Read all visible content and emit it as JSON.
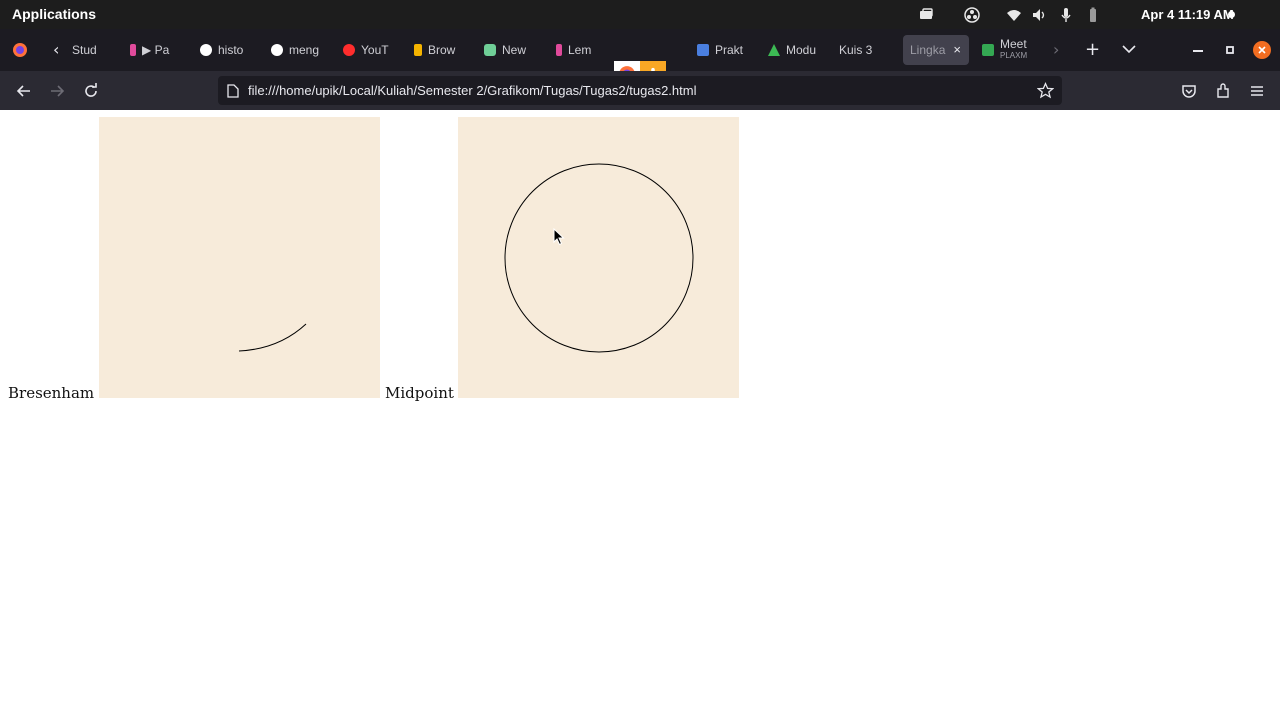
{
  "topbar": {
    "applications": "Applications",
    "clock": "Apr 4  11:19 AM",
    "icons": [
      "screen-icon",
      "obs-icon",
      "wifi-icon",
      "volume-icon",
      "mic-icon",
      "battery-icon"
    ]
  },
  "tabs": [
    {
      "label": "Stud",
      "color": "#c0c0c0"
    },
    {
      "label": "▶ Pa",
      "color": "#e04a9b"
    },
    {
      "label": "histo",
      "color": "#ffffff"
    },
    {
      "label": "meng",
      "color": "#ffffff"
    },
    {
      "label": "YouT",
      "color": "#ff2d2d"
    },
    {
      "label": "Brow",
      "color": "#f5b400"
    },
    {
      "label": "New",
      "color": "#6fcf97"
    },
    {
      "label": "Lem",
      "color": "#e04a9b"
    },
    {
      "label": "Prakt",
      "color": "#4a7fe0"
    },
    {
      "label": "Modu",
      "color": "#3cba54"
    },
    {
      "label": "Kuis 3",
      "color": ""
    },
    {
      "label": "Lingka",
      "color": ""
    },
    {
      "label": "Meet",
      "color": "#34a853"
    }
  ],
  "tab_sub": "PLAXM",
  "tab_close": "×",
  "new_tab": "+",
  "url": "file:///home/upik/Local/Kuliah/Semester 2/Grafikom/Tugas/Tugas2/tugas2.html",
  "page": {
    "bresenham_label": "Bresenham",
    "midpoint_label": "Midpoint",
    "canvas_bg": "#f7ebda"
  }
}
